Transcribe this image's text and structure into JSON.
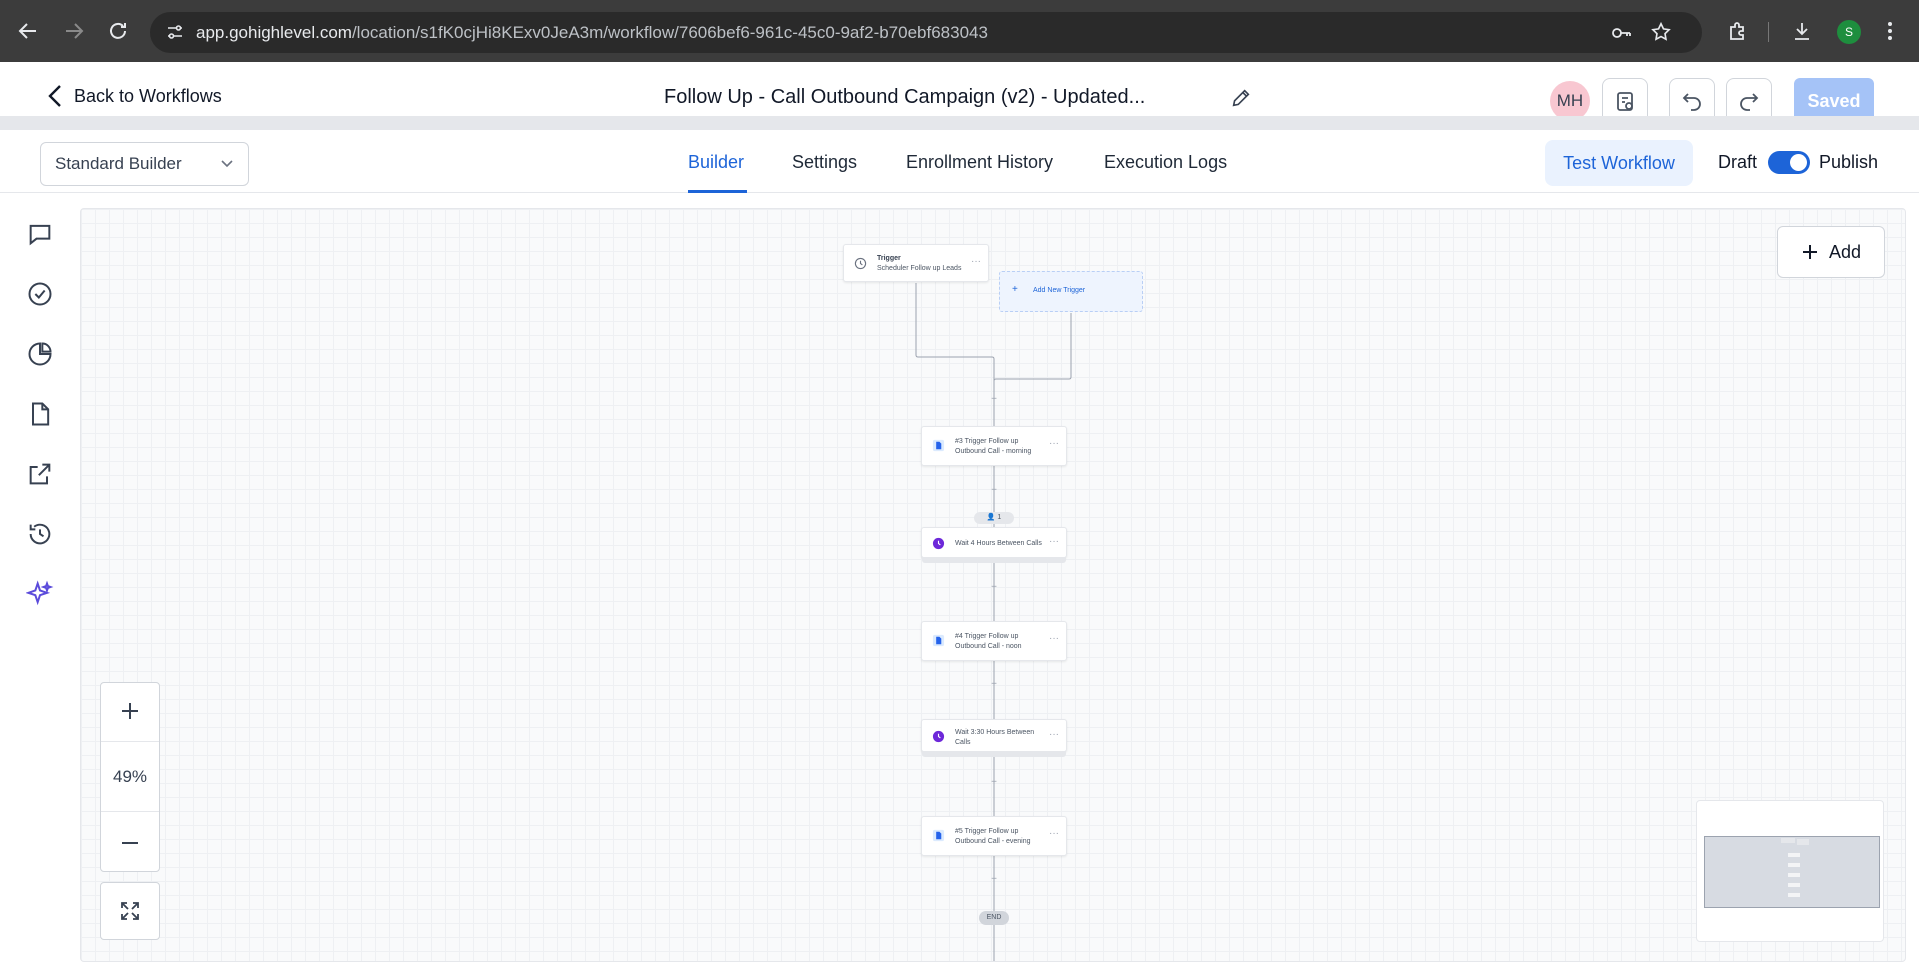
{
  "browser": {
    "url_host": "app.gohighlevel.com",
    "url_path": "/location/s1fK0cjHi8KExv0JeA3m/workflow/7606bef6-961c-45c0-9af2-b70ebf683043",
    "profile_initial": "S"
  },
  "header": {
    "back_label": "Back to Workflows",
    "title": "Follow Up - Call Outbound Campaign (v2) - Updated...",
    "avatar_initials": "MH",
    "saved_label": "Saved"
  },
  "toolbar": {
    "builder_select": "Standard Builder",
    "tabs": [
      {
        "label": "Builder",
        "active": true
      },
      {
        "label": "Settings",
        "active": false
      },
      {
        "label": "Enrollment History",
        "active": false
      },
      {
        "label": "Execution Logs",
        "active": false
      }
    ],
    "test_label": "Test Workflow",
    "draft_label": "Draft",
    "publish_label": "Publish",
    "published": true
  },
  "sidebar": {
    "icons": [
      "chat-icon",
      "check-circle-icon",
      "pie-chart-icon",
      "file-icon",
      "external-link-icon",
      "history-icon",
      "sparkles-icon"
    ]
  },
  "canvas": {
    "add_label": "Add",
    "zoom": "49%",
    "trigger": {
      "label": "Trigger",
      "name": "Scheduler Follow up Leads"
    },
    "add_trigger_label": "Add New Trigger",
    "contact_count": "1",
    "end_label": "END",
    "actions": [
      {
        "type": "workflow",
        "line1": "#3 Trigger Follow up",
        "line2": "Outbound Call - morning"
      },
      {
        "type": "wait",
        "line1": "Wait 4 Hours Between Calls",
        "line2": ""
      },
      {
        "type": "workflow",
        "line1": "#4 Trigger Follow up",
        "line2": "Outbound Call - noon"
      },
      {
        "type": "wait",
        "line1": "Wait 3:30 Hours Between",
        "line2": "Calls"
      },
      {
        "type": "workflow",
        "line1": "#5 Trigger Follow up",
        "line2": "Outbound Call - evening"
      }
    ]
  },
  "colors": {
    "accent": "#1d64d8",
    "wait_icon": "#6d28d9",
    "doc_icon": "#2563eb",
    "saved_bg": "#a5c3f7"
  }
}
